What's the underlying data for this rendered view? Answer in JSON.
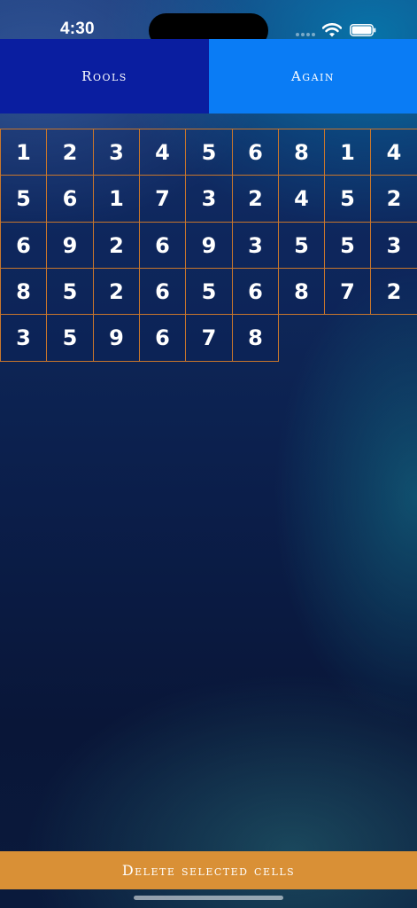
{
  "status_bar": {
    "time": "4:30",
    "icons": [
      "cellular-signal-icon",
      "wifi-icon",
      "battery-icon"
    ]
  },
  "toolbar": {
    "rools_label": "Rools",
    "again_label": "Again"
  },
  "board": {
    "rows": [
      [
        "1",
        "2",
        "3",
        "4",
        "5",
        "6",
        "8",
        "1",
        "4"
      ],
      [
        "5",
        "6",
        "1",
        "7",
        "3",
        "2",
        "4",
        "5",
        "2"
      ],
      [
        "6",
        "9",
        "2",
        "6",
        "9",
        "3",
        "5",
        "5",
        "3"
      ],
      [
        "8",
        "5",
        "2",
        "6",
        "5",
        "6",
        "8",
        "7",
        "2"
      ],
      [
        "3",
        "5",
        "9",
        "6",
        "7",
        "8"
      ]
    ]
  },
  "footer": {
    "delete_label": "Delete selected cells"
  },
  "colors": {
    "rools_button": "#0a1ea0",
    "again_button": "#0a7cf5",
    "cell_border": "#c8762c",
    "delete_button": "#d99036"
  }
}
